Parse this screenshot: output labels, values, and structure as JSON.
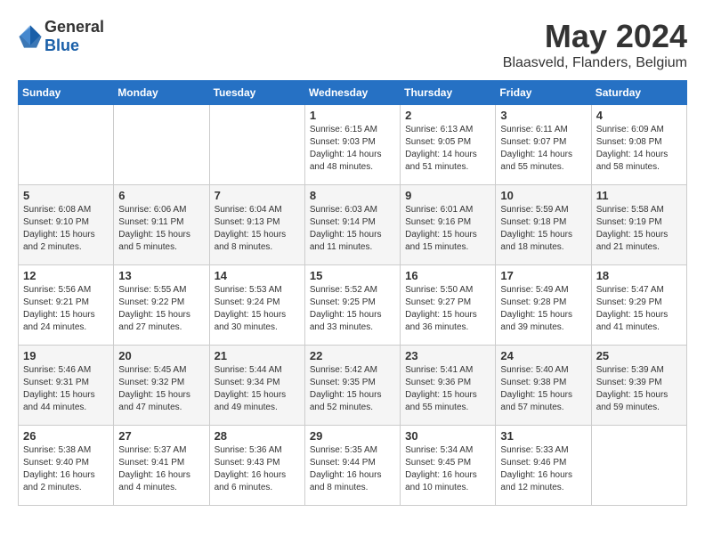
{
  "header": {
    "logo_general": "General",
    "logo_blue": "Blue",
    "month": "May 2024",
    "location": "Blaasveld, Flanders, Belgium"
  },
  "columns": [
    "Sunday",
    "Monday",
    "Tuesday",
    "Wednesday",
    "Thursday",
    "Friday",
    "Saturday"
  ],
  "weeks": [
    [
      {
        "day": "",
        "info": ""
      },
      {
        "day": "",
        "info": ""
      },
      {
        "day": "",
        "info": ""
      },
      {
        "day": "1",
        "info": "Sunrise: 6:15 AM\nSunset: 9:03 PM\nDaylight: 14 hours\nand 48 minutes."
      },
      {
        "day": "2",
        "info": "Sunrise: 6:13 AM\nSunset: 9:05 PM\nDaylight: 14 hours\nand 51 minutes."
      },
      {
        "day": "3",
        "info": "Sunrise: 6:11 AM\nSunset: 9:07 PM\nDaylight: 14 hours\nand 55 minutes."
      },
      {
        "day": "4",
        "info": "Sunrise: 6:09 AM\nSunset: 9:08 PM\nDaylight: 14 hours\nand 58 minutes."
      }
    ],
    [
      {
        "day": "5",
        "info": "Sunrise: 6:08 AM\nSunset: 9:10 PM\nDaylight: 15 hours\nand 2 minutes."
      },
      {
        "day": "6",
        "info": "Sunrise: 6:06 AM\nSunset: 9:11 PM\nDaylight: 15 hours\nand 5 minutes."
      },
      {
        "day": "7",
        "info": "Sunrise: 6:04 AM\nSunset: 9:13 PM\nDaylight: 15 hours\nand 8 minutes."
      },
      {
        "day": "8",
        "info": "Sunrise: 6:03 AM\nSunset: 9:14 PM\nDaylight: 15 hours\nand 11 minutes."
      },
      {
        "day": "9",
        "info": "Sunrise: 6:01 AM\nSunset: 9:16 PM\nDaylight: 15 hours\nand 15 minutes."
      },
      {
        "day": "10",
        "info": "Sunrise: 5:59 AM\nSunset: 9:18 PM\nDaylight: 15 hours\nand 18 minutes."
      },
      {
        "day": "11",
        "info": "Sunrise: 5:58 AM\nSunset: 9:19 PM\nDaylight: 15 hours\nand 21 minutes."
      }
    ],
    [
      {
        "day": "12",
        "info": "Sunrise: 5:56 AM\nSunset: 9:21 PM\nDaylight: 15 hours\nand 24 minutes."
      },
      {
        "day": "13",
        "info": "Sunrise: 5:55 AM\nSunset: 9:22 PM\nDaylight: 15 hours\nand 27 minutes."
      },
      {
        "day": "14",
        "info": "Sunrise: 5:53 AM\nSunset: 9:24 PM\nDaylight: 15 hours\nand 30 minutes."
      },
      {
        "day": "15",
        "info": "Sunrise: 5:52 AM\nSunset: 9:25 PM\nDaylight: 15 hours\nand 33 minutes."
      },
      {
        "day": "16",
        "info": "Sunrise: 5:50 AM\nSunset: 9:27 PM\nDaylight: 15 hours\nand 36 minutes."
      },
      {
        "day": "17",
        "info": "Sunrise: 5:49 AM\nSunset: 9:28 PM\nDaylight: 15 hours\nand 39 minutes."
      },
      {
        "day": "18",
        "info": "Sunrise: 5:47 AM\nSunset: 9:29 PM\nDaylight: 15 hours\nand 41 minutes."
      }
    ],
    [
      {
        "day": "19",
        "info": "Sunrise: 5:46 AM\nSunset: 9:31 PM\nDaylight: 15 hours\nand 44 minutes."
      },
      {
        "day": "20",
        "info": "Sunrise: 5:45 AM\nSunset: 9:32 PM\nDaylight: 15 hours\nand 47 minutes."
      },
      {
        "day": "21",
        "info": "Sunrise: 5:44 AM\nSunset: 9:34 PM\nDaylight: 15 hours\nand 49 minutes."
      },
      {
        "day": "22",
        "info": "Sunrise: 5:42 AM\nSunset: 9:35 PM\nDaylight: 15 hours\nand 52 minutes."
      },
      {
        "day": "23",
        "info": "Sunrise: 5:41 AM\nSunset: 9:36 PM\nDaylight: 15 hours\nand 55 minutes."
      },
      {
        "day": "24",
        "info": "Sunrise: 5:40 AM\nSunset: 9:38 PM\nDaylight: 15 hours\nand 57 minutes."
      },
      {
        "day": "25",
        "info": "Sunrise: 5:39 AM\nSunset: 9:39 PM\nDaylight: 15 hours\nand 59 minutes."
      }
    ],
    [
      {
        "day": "26",
        "info": "Sunrise: 5:38 AM\nSunset: 9:40 PM\nDaylight: 16 hours\nand 2 minutes."
      },
      {
        "day": "27",
        "info": "Sunrise: 5:37 AM\nSunset: 9:41 PM\nDaylight: 16 hours\nand 4 minutes."
      },
      {
        "day": "28",
        "info": "Sunrise: 5:36 AM\nSunset: 9:43 PM\nDaylight: 16 hours\nand 6 minutes."
      },
      {
        "day": "29",
        "info": "Sunrise: 5:35 AM\nSunset: 9:44 PM\nDaylight: 16 hours\nand 8 minutes."
      },
      {
        "day": "30",
        "info": "Sunrise: 5:34 AM\nSunset: 9:45 PM\nDaylight: 16 hours\nand 10 minutes."
      },
      {
        "day": "31",
        "info": "Sunrise: 5:33 AM\nSunset: 9:46 PM\nDaylight: 16 hours\nand 12 minutes."
      },
      {
        "day": "",
        "info": ""
      }
    ]
  ]
}
